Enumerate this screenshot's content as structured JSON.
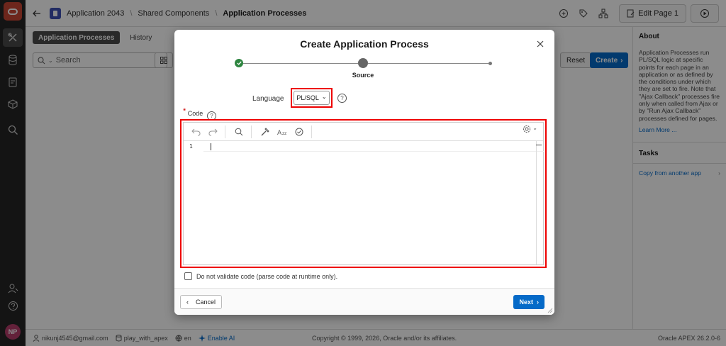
{
  "header": {
    "breadcrumbs": [
      "Application 2043",
      "Shared Components",
      "Application Processes"
    ],
    "edit_page_label": "Edit Page 1"
  },
  "main": {
    "tabs": [
      {
        "label": "Application Processes",
        "active": true
      },
      {
        "label": "History",
        "active": false
      }
    ],
    "search_placeholder": "Search",
    "reset_label": "Reset",
    "create_label": "Create"
  },
  "sidebar": {
    "about_title": "About",
    "about_text": "Application Processes run PL/SQL logic at specific points for each page in an application or as defined by the conditions under which they are set to fire. Note that \"Ajax Callback\" processes fire only when called from Ajax or by \"Run Ajax Callback\" processes defined for pages.",
    "learn_more": "Learn More ...",
    "tasks_title": "Tasks",
    "tasks": [
      {
        "label": "Copy from another app"
      }
    ]
  },
  "footer": {
    "user_email": "nikunj4545@gmail.com",
    "workspace": "play_with_apex",
    "language": "en",
    "enable_ai": "Enable AI",
    "copyright": "Copyright © 1999, 2026, Oracle and/or its affiliates.",
    "version": "Oracle APEX 26.2.0-6"
  },
  "user": {
    "initials": "NP"
  },
  "modal": {
    "title": "Create Application Process",
    "steps": [
      {
        "state": "done"
      },
      {
        "state": "current",
        "label": "Source"
      },
      {
        "state": "pending"
      }
    ],
    "language_label": "Language",
    "language_value": "PL/SQL",
    "code_label": "Code",
    "editor": {
      "line_numbers": [
        "1"
      ],
      "content": ""
    },
    "checkbox_label": "Do not validate code (parse code at runtime only).",
    "cancel_label": "Cancel",
    "next_label": "Next"
  },
  "colors": {
    "accent": "#056ac8",
    "highlight": "#e00000",
    "brand": "#c74634",
    "success": "#2e8540"
  }
}
